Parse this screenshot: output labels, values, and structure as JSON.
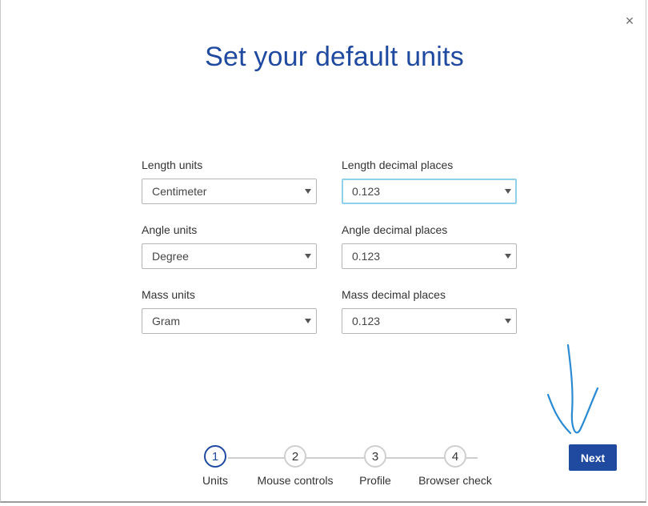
{
  "dialog": {
    "close_label": "×",
    "title": "Set your default units"
  },
  "form": {
    "length_units": {
      "label": "Length units",
      "value": "Centimeter"
    },
    "length_decimals": {
      "label": "Length decimal places",
      "value": "0.123"
    },
    "angle_units": {
      "label": "Angle units",
      "value": "Degree"
    },
    "angle_decimals": {
      "label": "Angle decimal places",
      "value": "0.123"
    },
    "mass_units": {
      "label": "Mass units",
      "value": "Gram"
    },
    "mass_decimals": {
      "label": "Mass decimal places",
      "value": "0.123"
    }
  },
  "stepper": {
    "steps": [
      {
        "number": "1",
        "label": "Units",
        "active": true
      },
      {
        "number": "2",
        "label": "Mouse controls",
        "active": false
      },
      {
        "number": "3",
        "label": "Profile",
        "active": false
      },
      {
        "number": "4",
        "label": "Browser check",
        "active": false
      }
    ]
  },
  "actions": {
    "next_label": "Next"
  },
  "colors": {
    "accent": "#1f4aa0",
    "focus_border": "#8fd0ea",
    "annotation_ink": "#2a8ad4"
  }
}
